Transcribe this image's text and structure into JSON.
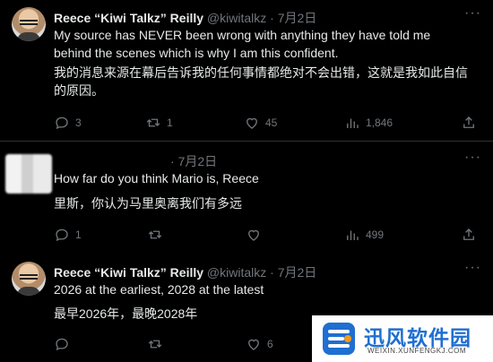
{
  "tweets": [
    {
      "name": "Reece “Kiwi Talkz” Reilly",
      "handle": "@kiwitalkz",
      "dot": "·",
      "date": "7月2日",
      "text_en": "My source has NEVER been wrong with anything they have told me behind the scenes which is why I am this confident.",
      "text_zh": "我的消息来源在幕后告诉我的任何事情都绝对不会出错，这就是我如此自信的原因。",
      "replies": "3",
      "retweets": "1",
      "likes": "45",
      "views": "1,846"
    },
    {
      "dot": "·",
      "date": "7月2日",
      "text_en": "How far do you think Mario is, Reece",
      "text_zh": "里斯，你认为马里奥离我们有多远",
      "replies": "1",
      "retweets": "",
      "likes": "",
      "views": "499"
    },
    {
      "name": "Reece “Kiwi Talkz” Reilly",
      "handle": "@kiwitalkz",
      "dot": "·",
      "date": "7月2日",
      "text_en": "2026 at the earliest, 2028 at the latest",
      "text_zh": "最早2026年，最晚2028年",
      "replies": "",
      "retweets": "",
      "likes": "6"
    }
  ],
  "watermark": {
    "title": "迅风软件园",
    "subtitle": "WEIXIN.XUNFENGKJ.COM"
  },
  "colors": {
    "background": "#000000",
    "text": "#e7e9ea",
    "muted": "#71767b",
    "divider": "#2f3336",
    "watermark_blue": "#1f6fd1"
  },
  "icons": [
    "more-icon",
    "reply-icon",
    "retweet-icon",
    "like-icon",
    "views-icon",
    "share-icon"
  ]
}
